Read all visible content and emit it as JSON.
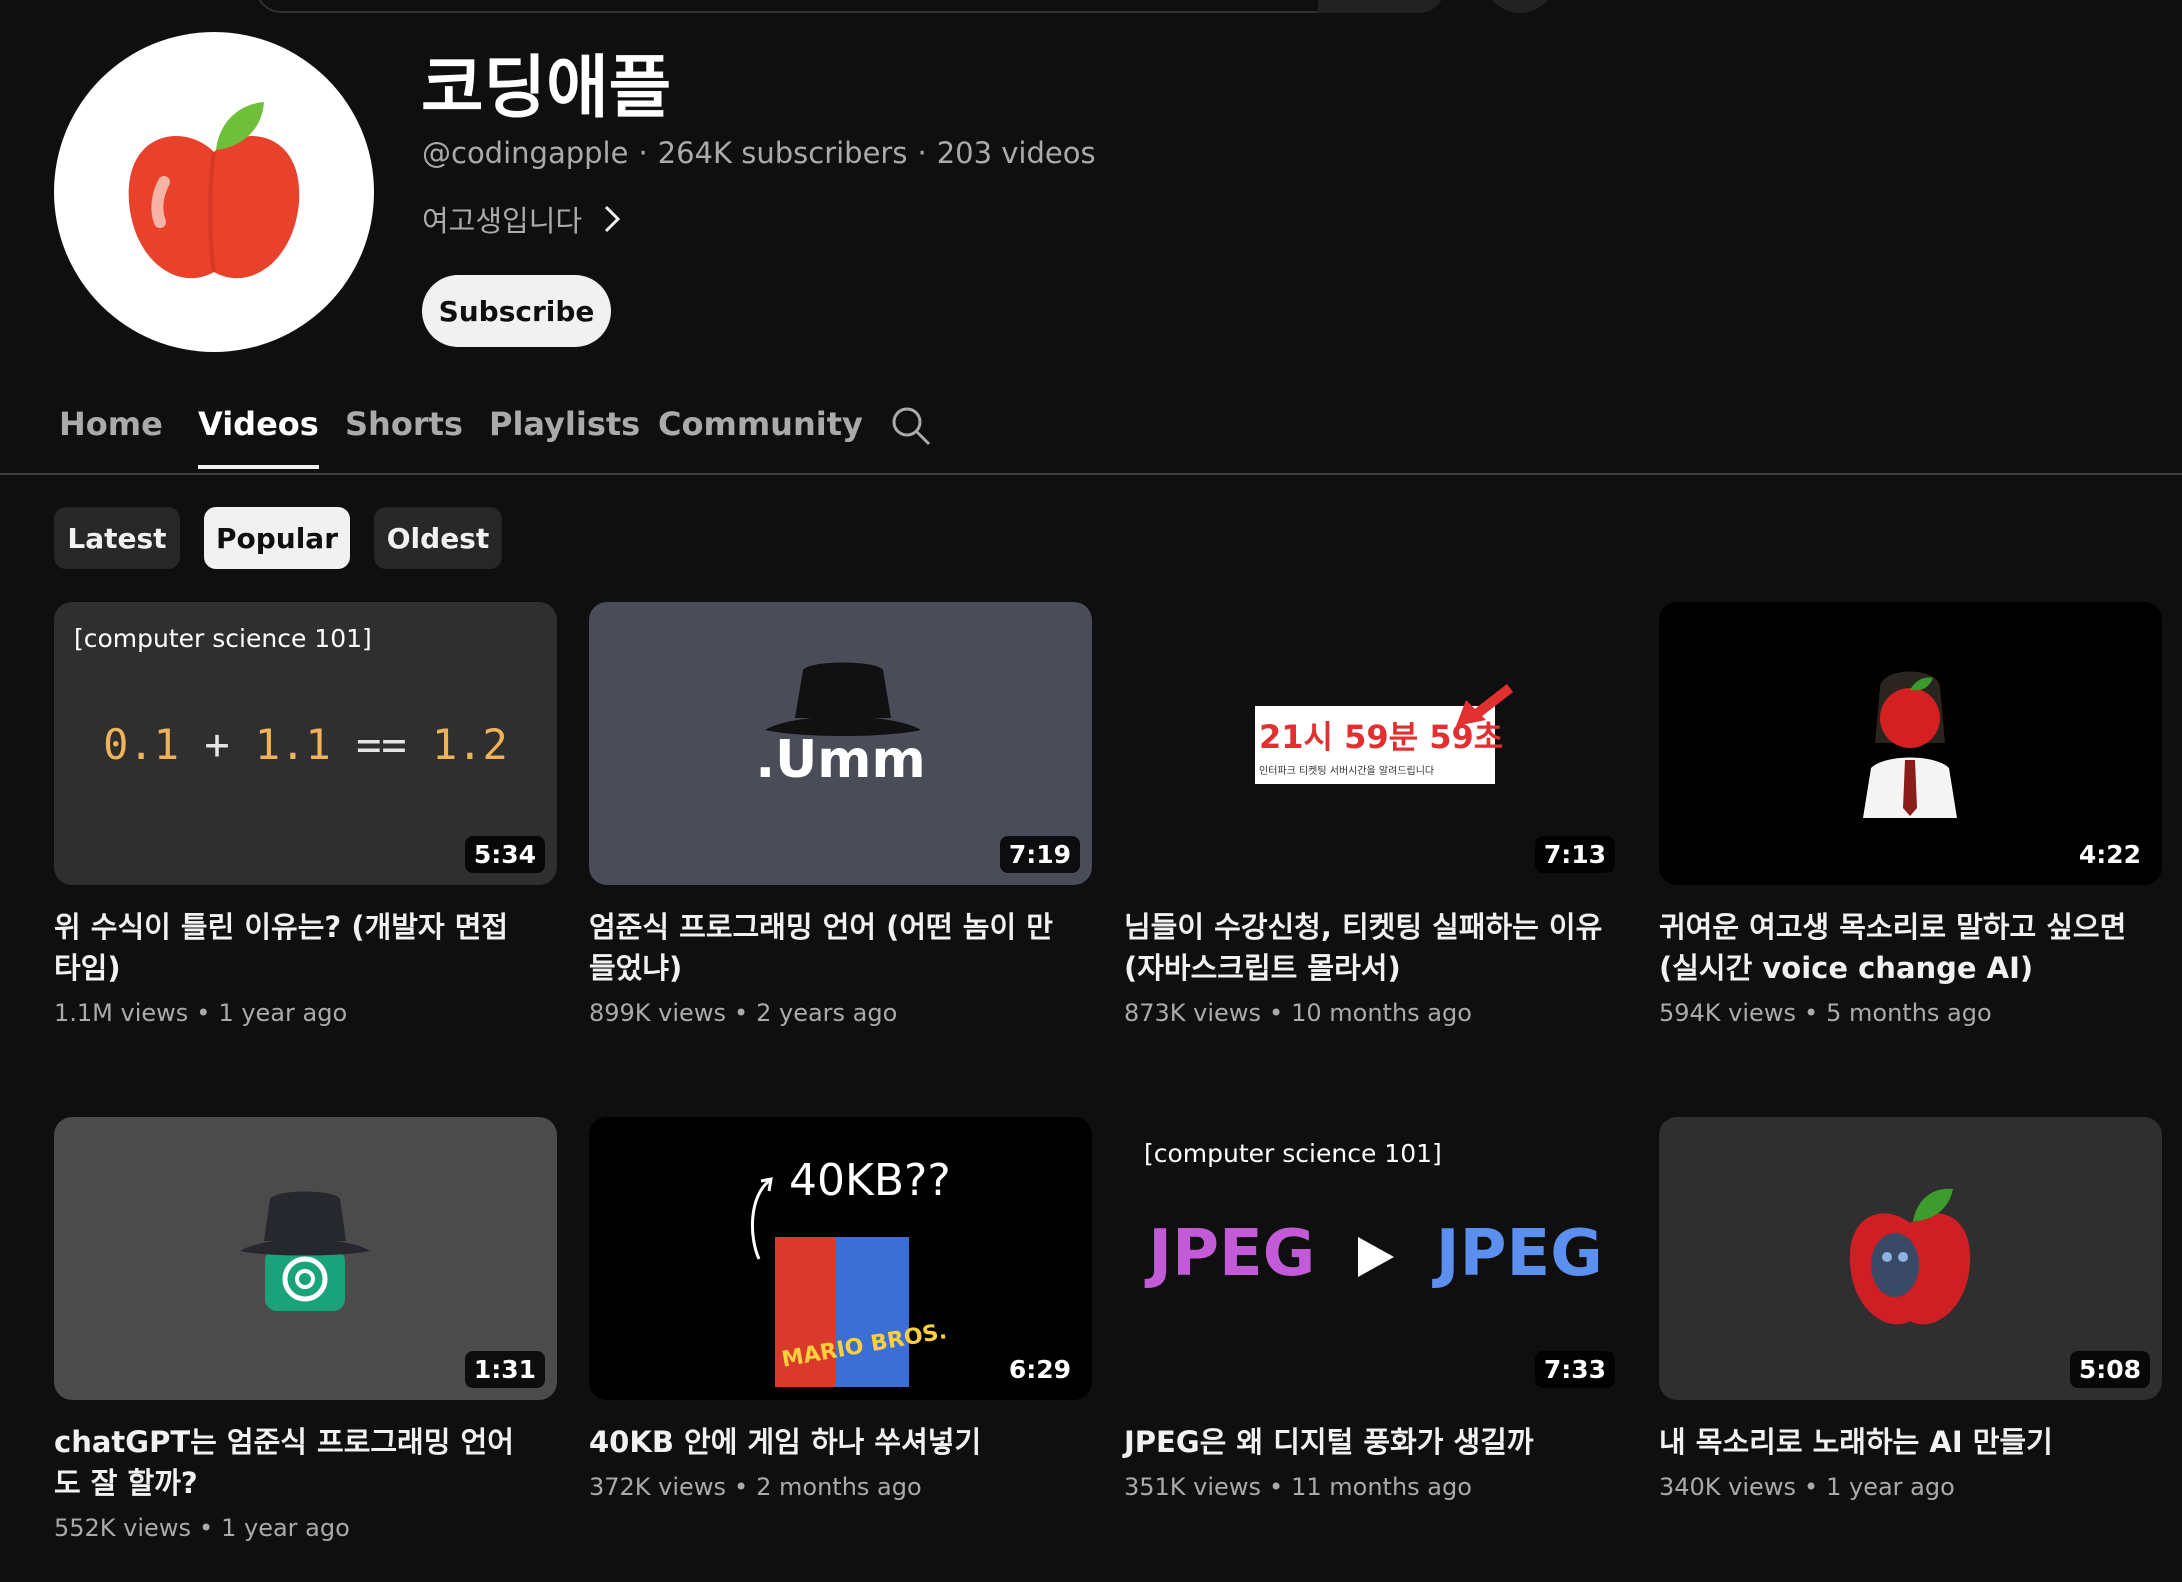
{
  "channel": {
    "name": "코딩애플",
    "handle": "@codingapple",
    "subscribers": "264K subscribers",
    "videos": "203 videos",
    "separator": "·",
    "description": "여고생입니다",
    "subscribe_label": "Subscribe"
  },
  "tabs": [
    {
      "label": "Home"
    },
    {
      "label": "Videos"
    },
    {
      "label": "Shorts"
    },
    {
      "label": "Playlists"
    },
    {
      "label": "Community"
    }
  ],
  "active_tab": "Videos",
  "chips": [
    {
      "label": "Latest"
    },
    {
      "label": "Popular"
    },
    {
      "label": "Oldest"
    }
  ],
  "active_chip": "Popular",
  "videos": [
    {
      "title": "위 수식이 틀린 이유는? (개발자 면접 타임)",
      "views": "1.1M views",
      "age": "1 year ago",
      "duration": "5:34",
      "thumb": {
        "tag": "[computer science 101]",
        "a": "0.1",
        "op": "+",
        "b": "1.1",
        "eq": "==",
        "c": "1.2"
      }
    },
    {
      "title": "엄준식 프로그래밍 언어 (어떤 놈이 만들었냐)",
      "views": "899K views",
      "age": "2 years ago",
      "duration": "7:19",
      "thumb": {
        "text": ".Umm"
      }
    },
    {
      "title": "님들이 수강신청, 티켓팅 실패하는 이유 (자바스크립트 몰라서)",
      "views": "873K views",
      "age": "10 months ago",
      "duration": "7:13",
      "thumb": {
        "headline": "21시 59분 59초",
        "caption": "인터파크 티켓팅 서버시간을 알려드립니다"
      }
    },
    {
      "title": "귀여운 여고생 목소리로 말하고 싶으면 (실시간 voice change AI)",
      "views": "594K views",
      "age": "5 months ago",
      "duration": "4:22",
      "thumb": {}
    },
    {
      "title": "chatGPT는 엄준식 프로그래밍 언어도 잘 할까?",
      "views": "552K views",
      "age": "1 year ago",
      "duration": "1:31",
      "thumb": {}
    },
    {
      "title": "40KB 안에 게임 하나 쑤셔넣기",
      "views": "372K views",
      "age": "2 months ago",
      "duration": "6:29",
      "thumb": {
        "text": "40KB??",
        "game": "MARIO BROS."
      }
    },
    {
      "title": "JPEG은 왜 디지털 풍화가 생길까",
      "views": "351K views",
      "age": "11 months ago",
      "duration": "7:33",
      "thumb": {
        "tag": "[computer science 101]",
        "left": "JPEG",
        "right": "JPEG"
      }
    },
    {
      "title": "내 목소리로 노래하는 AI 만들기",
      "views": "340K views",
      "age": "1 year ago",
      "duration": "5:08",
      "thumb": {}
    }
  ],
  "meta_separator": "•",
  "colors": {
    "background": "#0f0f0f",
    "secondary_text": "#aaaaaa",
    "apple_red": "#e8412c",
    "leaf_green": "#6fbf3a"
  }
}
